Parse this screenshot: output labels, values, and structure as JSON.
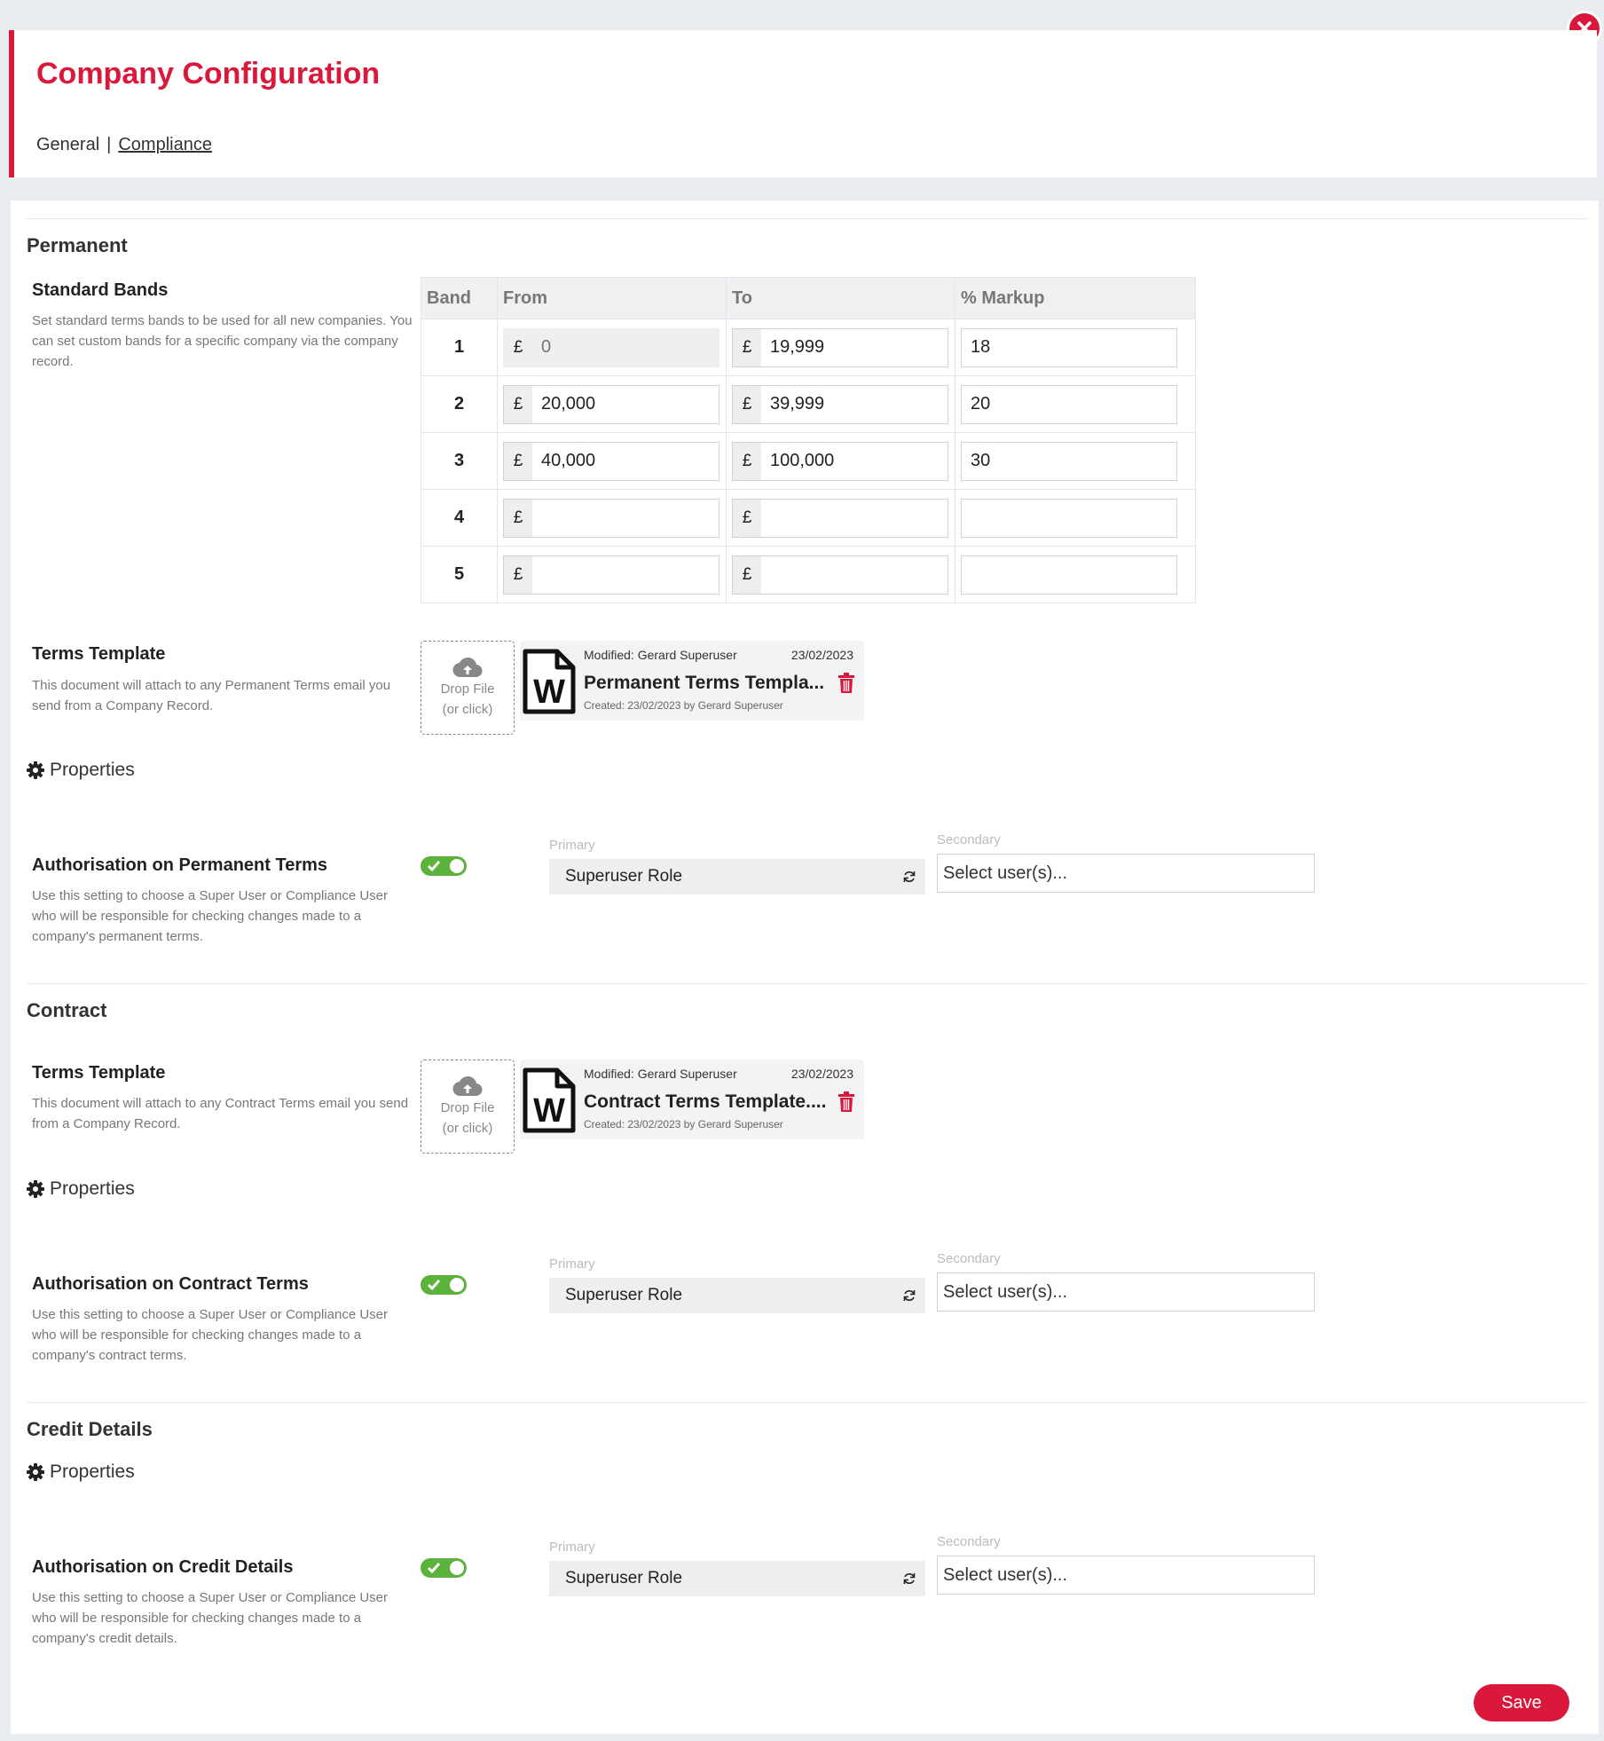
{
  "header": {
    "title": "Company Configuration",
    "tabs": [
      {
        "label": "General"
      },
      {
        "label": "Compliance"
      }
    ],
    "separator": "|"
  },
  "permanent": {
    "section_title": "Permanent",
    "standard_bands": {
      "title": "Standard Bands",
      "description": "Set standard terms bands to be used for all new companies. You can set custom bands for a specific company via the company record.",
      "columns": [
        "Band",
        "From",
        "To",
        "% Markup"
      ],
      "currency": "£",
      "rows": [
        {
          "band": "1",
          "from": "",
          "from_placeholder": "0",
          "to": "19,999",
          "markup": "18"
        },
        {
          "band": "2",
          "from": "20,000",
          "from_placeholder": "",
          "to": "39,999",
          "markup": "20"
        },
        {
          "band": "3",
          "from": "40,000",
          "from_placeholder": "",
          "to": "100,000",
          "markup": "30"
        },
        {
          "band": "4",
          "from": "",
          "from_placeholder": "",
          "to": "",
          "markup": ""
        },
        {
          "band": "5",
          "from": "",
          "from_placeholder": "",
          "to": "",
          "markup": ""
        }
      ]
    },
    "terms_template": {
      "title": "Terms Template",
      "description": "This document will attach to any Permanent Terms email you send from a Company Record.",
      "drop_line1": "Drop File",
      "drop_line2": "(or click)",
      "file": {
        "modified": "Modified: Gerard Superuser",
        "date": "23/02/2023",
        "name": "Permanent Terms Templa...",
        "created": "Created: 23/02/2023 by Gerard Superuser"
      }
    },
    "properties_label": "Properties",
    "authorisation": {
      "title": "Authorisation on Permanent Terms",
      "description": "Use this setting to choose a Super User or Compliance User who will be responsible for checking changes made to a company's permanent terms.",
      "enabled": true,
      "primary_caption": "Primary",
      "primary_value": "Superuser Role",
      "secondary_caption": "Secondary",
      "secondary_placeholder": "Select user(s)..."
    }
  },
  "contract": {
    "section_title": "Contract",
    "terms_template": {
      "title": "Terms Template",
      "description": "This document will attach to any Contract Terms email you send from a Company Record.",
      "drop_line1": "Drop File",
      "drop_line2": "(or click)",
      "file": {
        "modified": "Modified: Gerard Superuser",
        "date": "23/02/2023",
        "name": "Contract Terms Template....",
        "created": "Created: 23/02/2023 by Gerard Superuser"
      }
    },
    "properties_label": "Properties",
    "authorisation": {
      "title": "Authorisation on Contract Terms",
      "description": "Use this setting to choose a Super User or Compliance User who will be responsible for checking changes made to a company's contract terms.",
      "enabled": true,
      "primary_caption": "Primary",
      "primary_value": "Superuser Role",
      "secondary_caption": "Secondary",
      "secondary_placeholder": "Select user(s)..."
    }
  },
  "credit": {
    "section_title": "Credit Details",
    "properties_label": "Properties",
    "authorisation": {
      "title": "Authorisation on Credit Details",
      "description": "Use this setting to choose a Super User or Compliance User who will be responsible for checking changes made to a company's credit details.",
      "enabled": true,
      "primary_caption": "Primary",
      "primary_value": "Superuser Role",
      "secondary_caption": "Secondary",
      "secondary_placeholder": "Select user(s)..."
    }
  },
  "footer": {
    "save_label": "Save"
  },
  "colors": {
    "accent": "#d9183b",
    "toggle_on": "#5bb33b",
    "muted_text": "#777777"
  }
}
